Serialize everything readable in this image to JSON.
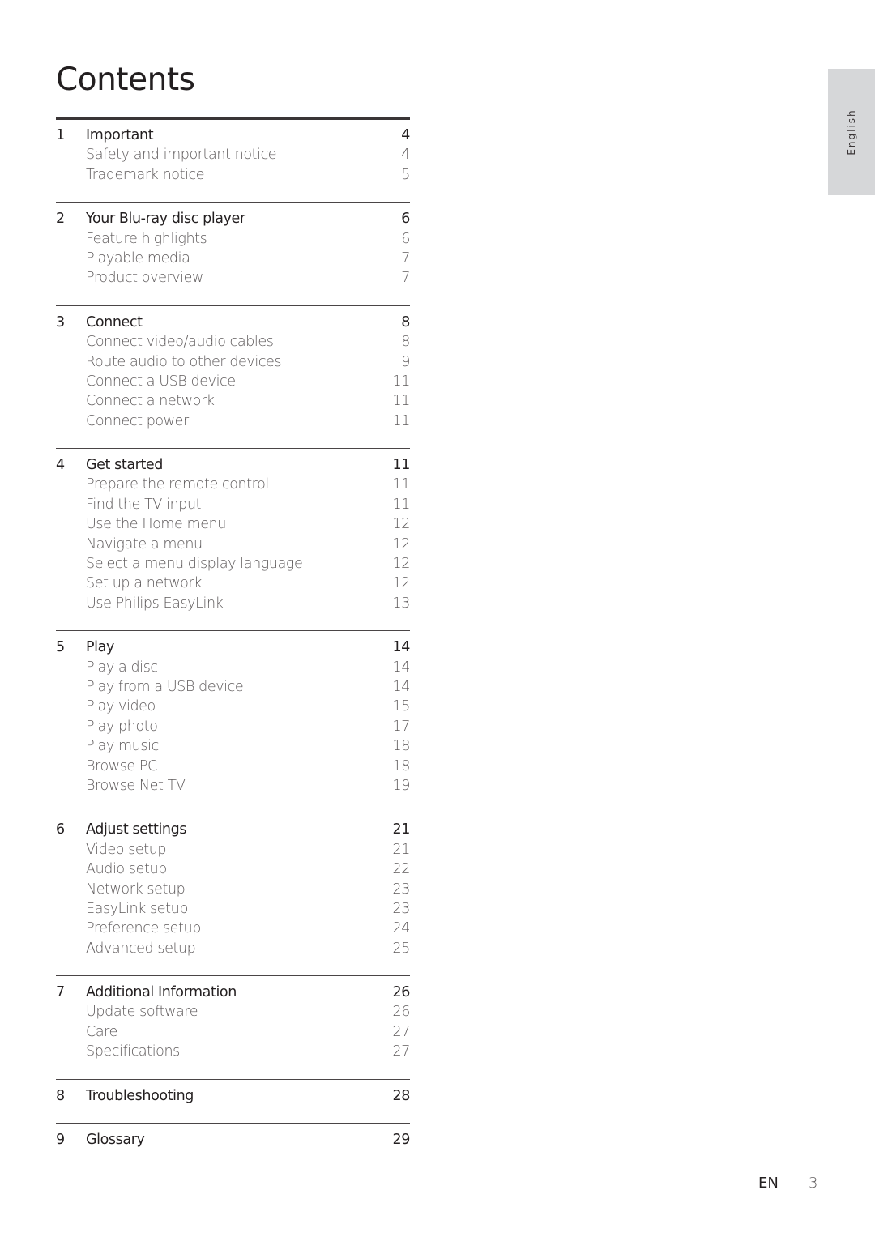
{
  "title": "Contents",
  "language_tab": "English",
  "footer": {
    "language": "EN",
    "page_number": "3"
  },
  "sections": [
    {
      "number": "1",
      "title": "Important",
      "page": "4",
      "items": [
        {
          "title": "Safety and important notice",
          "page": "4"
        },
        {
          "title": "Trademark notice",
          "page": "5"
        }
      ]
    },
    {
      "number": "2",
      "title": "Your Blu-ray disc player",
      "page": "6",
      "items": [
        {
          "title": "Feature highlights",
          "page": "6"
        },
        {
          "title": "Playable media",
          "page": "7"
        },
        {
          "title": "Product overview",
          "page": "7"
        }
      ]
    },
    {
      "number": "3",
      "title": "Connect",
      "page": "8",
      "items": [
        {
          "title": "Connect video/audio cables",
          "page": "8"
        },
        {
          "title": "Route audio to other devices",
          "page": "9"
        },
        {
          "title": "Connect a USB device",
          "page": "11"
        },
        {
          "title": "Connect a network",
          "page": "11"
        },
        {
          "title": "Connect power",
          "page": "11"
        }
      ]
    },
    {
      "number": "4",
      "title": "Get started",
      "page": "11",
      "items": [
        {
          "title": "Prepare the remote control",
          "page": "11"
        },
        {
          "title": "Find the TV input",
          "page": "11"
        },
        {
          "title": "Use the Home menu",
          "page": "12"
        },
        {
          "title": "Navigate a menu",
          "page": "12"
        },
        {
          "title": "Select a menu display language",
          "page": "12"
        },
        {
          "title": "Set up a network",
          "page": "12"
        },
        {
          "title": "Use Philips EasyLink",
          "page": "13"
        }
      ]
    },
    {
      "number": "5",
      "title": "Play",
      "page": "14",
      "items": [
        {
          "title": "Play a disc",
          "page": "14"
        },
        {
          "title": "Play from a USB device",
          "page": "14"
        },
        {
          "title": "Play video",
          "page": "15"
        },
        {
          "title": "Play photo",
          "page": "17"
        },
        {
          "title": "Play music",
          "page": "18"
        },
        {
          "title": "Browse PC",
          "page": "18"
        },
        {
          "title": "Browse Net TV",
          "page": "19"
        }
      ]
    },
    {
      "number": "6",
      "title": "Adjust settings",
      "page": "21",
      "items": [
        {
          "title": "Video setup",
          "page": "21"
        },
        {
          "title": "Audio setup",
          "page": "22"
        },
        {
          "title": "Network setup",
          "page": "23"
        },
        {
          "title": "EasyLink setup",
          "page": "23"
        },
        {
          "title": "Preference setup",
          "page": "24"
        },
        {
          "title": "Advanced setup",
          "page": "25"
        }
      ]
    },
    {
      "number": "7",
      "title": "Additional Information",
      "page": "26",
      "items": [
        {
          "title": "Update software",
          "page": "26"
        },
        {
          "title": "Care",
          "page": "27"
        },
        {
          "title": "Specifications",
          "page": "27"
        }
      ]
    },
    {
      "number": "8",
      "title": "Troubleshooting",
      "page": "28",
      "items": []
    },
    {
      "number": "9",
      "title": "Glossary",
      "page": "29",
      "items": []
    }
  ]
}
